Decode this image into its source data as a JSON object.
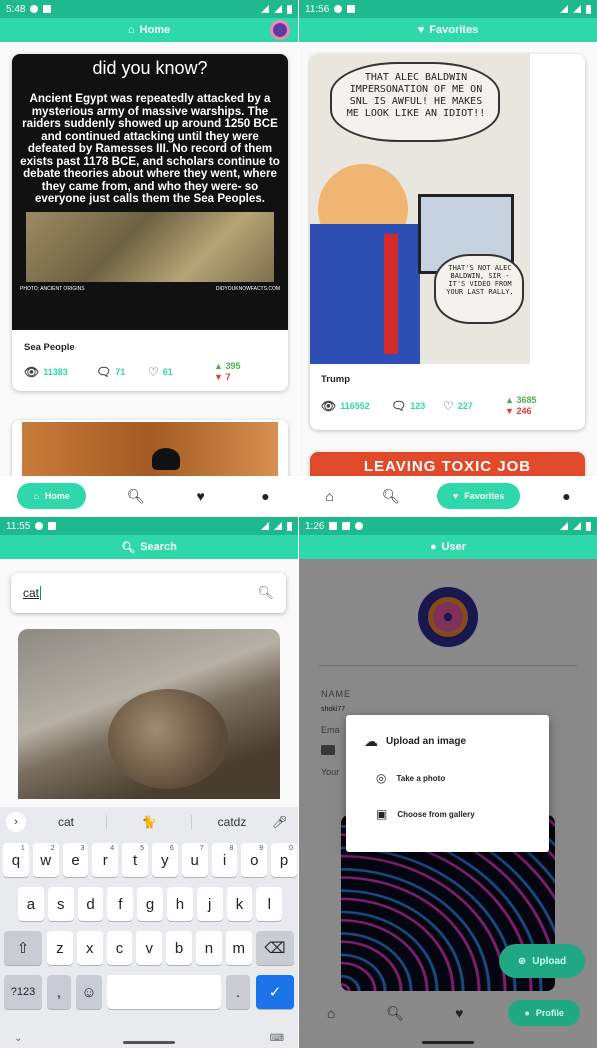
{
  "q1": {
    "status_time": "5:48",
    "title": "Home",
    "card": {
      "headline": "did you know?",
      "body": "Ancient Egypt was repeatedly attacked by a mysterious army of massive warships. The raiders suddenly showed up around 1250 BCE and continued attacking until they were defeated by Ramesses III. No record of them exists past 1178 BCE, and scholars continue to debate theories about where they went, where they came from, and who they were- so everyone just calls them the Sea Peoples.",
      "photo_credit": "PHOTO: ANCIENT ORIGINS",
      "site": "DIDYOUKNOWFACTS.COM",
      "title": "Sea People",
      "views": "11383",
      "comments": "71",
      "likes": "61",
      "upvotes": "395",
      "downvotes": "7"
    },
    "nav_home": "Home"
  },
  "q2": {
    "status_time": "11:56",
    "title": "Favorites",
    "cartoon_top": "THAT ALEC BALDWIN IMPERSONATION OF ME ON SNL IS AWFUL! HE MAKES ME LOOK LIKE AN IDIOT!!",
    "cartoon_bottom": "THAT'S NOT ALEC BALDWIN, SIR - IT'S VIDEO FROM YOUR LAST RALLY.",
    "card_title": "Trump",
    "views": "116552",
    "comments": "123",
    "likes": "227",
    "upvotes": "3685",
    "downvotes": "246",
    "next_card_text": "LEAVING TOXIC JOB",
    "nav_favorites": "Favorites"
  },
  "q3": {
    "status_time": "11:55",
    "title": "Search",
    "search_value": "cat",
    "suggestions": [
      "cat",
      "🐈",
      "catdz"
    ],
    "rows": [
      [
        "q",
        "w",
        "e",
        "r",
        "t",
        "y",
        "u",
        "i",
        "o",
        "p"
      ],
      [
        "a",
        "s",
        "d",
        "f",
        "g",
        "h",
        "j",
        "k",
        "l"
      ],
      [
        "z",
        "x",
        "c",
        "v",
        "b",
        "n",
        "m"
      ]
    ],
    "digits": [
      "1",
      "2",
      "3",
      "4",
      "5",
      "6",
      "7",
      "8",
      "9",
      "0"
    ],
    "sym_key": "?123",
    "comma": ",",
    "period": "."
  },
  "q4": {
    "status_time": "1:26",
    "title": "User",
    "name_label": "NAME",
    "name_value": "shoki77",
    "email_label": "Ema",
    "your_label": "Your",
    "dialog_title": "Upload an image",
    "take_photo": "Take a photo",
    "gallery": "Choose from gallery",
    "upload_btn": "Upload",
    "nav_profile": "Profile"
  },
  "colors": {
    "accent": "#2ed8a8",
    "status": "#1fb98e",
    "up": "#4caf50",
    "down": "#e53935"
  }
}
